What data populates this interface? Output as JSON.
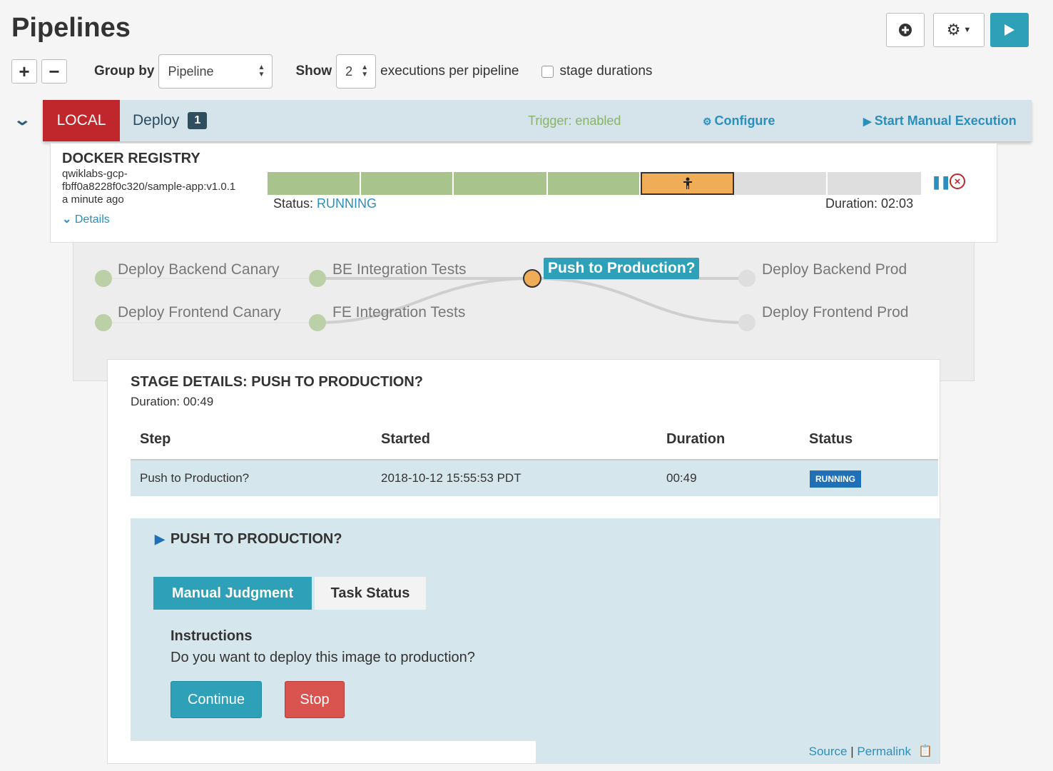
{
  "page": {
    "title": "Pipelines"
  },
  "toolbar": {
    "create_icon": "plus-circle-icon",
    "settings_icon": "gear-icon",
    "run_icon": "play-icon",
    "expand_label": "+",
    "collapse_label": "−",
    "group_by_label": "Group by",
    "group_by_value": "Pipeline",
    "show_label": "Show",
    "show_value": "2",
    "per_pipeline_label": "executions per pipeline",
    "stage_durations_label": "stage durations",
    "stage_durations_checked": false
  },
  "group": {
    "application": "LOCAL",
    "pipeline": "Deploy",
    "count": "1",
    "trigger": "Trigger: enabled",
    "configure": "Configure",
    "start_manual": "Start Manual Execution"
  },
  "execution": {
    "trigger_type": "DOCKER REGISTRY",
    "image_line1": "qwiklabs-gcp-",
    "image_line2": "fbff0a8228f0c320/sample-app:v1.0.1",
    "when": "a minute ago",
    "details": "Details",
    "status_label": "Status:",
    "status_value": "RUNNING",
    "duration": "Duration: 02:03",
    "stages_succeeded": 4,
    "stage_running_index": 4,
    "stages_not_started": 2
  },
  "graph": {
    "nodes": [
      "Deploy Backend Canary",
      "Deploy Frontend Canary",
      "BE Integration Tests",
      "FE Integration Tests",
      "Push to Production?",
      "Deploy Backend Prod",
      "Deploy Frontend Prod"
    ],
    "colors": {
      "succeeded": "#a8c48c",
      "running": "#f0ad57",
      "not_started": "#dedede",
      "accent": "#2ea1b8"
    }
  },
  "stage_details": {
    "title": "STAGE DETAILS: PUSH TO PRODUCTION?",
    "duration": "Duration: 00:49",
    "columns": [
      "Step",
      "Started",
      "Duration",
      "Status"
    ],
    "rows": [
      {
        "step": "Push to Production?",
        "started": "2018-10-12 15:55:53 PDT",
        "duration": "00:49",
        "status": "RUNNING"
      }
    ]
  },
  "judgment": {
    "title": "PUSH TO PRODUCTION?",
    "tabs": [
      "Manual Judgment",
      "Task Status"
    ],
    "instructions_heading": "Instructions",
    "instructions_text": "Do you want to deploy this image to production?",
    "continue_label": "Continue",
    "stop_label": "Stop"
  },
  "footer": {
    "source": "Source",
    "separator": "|",
    "permalink": "Permalink"
  }
}
